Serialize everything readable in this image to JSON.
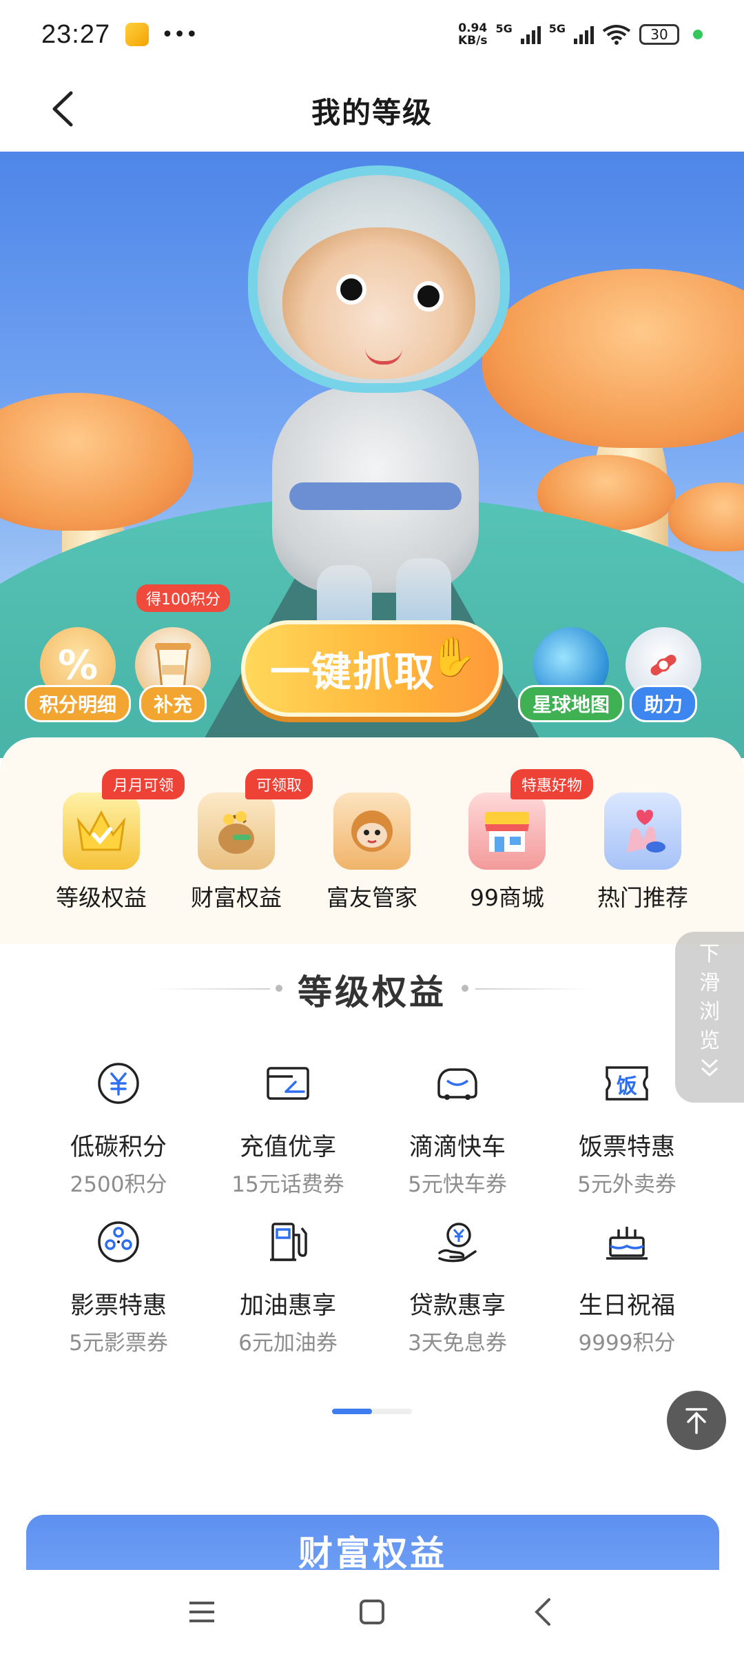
{
  "status_bar": {
    "time": "23:27",
    "dots": "•••",
    "net_speed_value": "0.94",
    "net_speed_unit": "KB/s",
    "signal1_label": "5G",
    "signal2_label": "5G",
    "battery": "30"
  },
  "header": {
    "title": "我的等级"
  },
  "hero": {
    "badges": [
      {
        "label": "积分明细",
        "glyph": "%",
        "color": "#f3a531"
      },
      {
        "label": "补充",
        "tip": "得100积分",
        "color": "#f3a531"
      },
      {
        "label": "星球地图",
        "color": "#3fb153"
      },
      {
        "label": "助力",
        "color": "#3d86f0"
      }
    ],
    "grab_button": "一键抓取"
  },
  "entries": [
    {
      "label": "等级权益",
      "tip": "月月可领",
      "icon": "crown-icon"
    },
    {
      "label": "财富权益",
      "tip": "可领取",
      "icon": "money-bag-icon"
    },
    {
      "label": "富友管家",
      "icon": "monkey-icon"
    },
    {
      "label": "99商城",
      "tip": "特惠好物",
      "icon": "shop-icon"
    },
    {
      "label": "热门推荐",
      "icon": "hand-heart-icon"
    }
  ],
  "section": {
    "title": "等级权益"
  },
  "benefits": [
    {
      "name": "低碳积分",
      "desc": "2500积分",
      "icon": "yuan-icon"
    },
    {
      "name": "充值优享",
      "desc": "15元话费券",
      "icon": "card-icon"
    },
    {
      "name": "滴滴快车",
      "desc": "5元快车券",
      "icon": "car-icon"
    },
    {
      "name": "饭票特惠",
      "desc": "5元外卖券",
      "icon": "meal-ticket-icon",
      "glyph": "饭"
    },
    {
      "name": "影票特惠",
      "desc": "5元影票券",
      "icon": "film-reel-icon"
    },
    {
      "name": "加油惠享",
      "desc": "6元加油券",
      "icon": "gas-pump-icon"
    },
    {
      "name": "贷款惠享",
      "desc": "3天免息券",
      "icon": "loan-icon"
    },
    {
      "name": "生日祝福",
      "desc": "9999积分",
      "icon": "cake-icon"
    }
  ],
  "side_tab": {
    "chars": [
      "下",
      "滑",
      "浏",
      "览"
    ]
  },
  "wealth": {
    "title": "财富权益"
  },
  "pager": {
    "active_index": 0,
    "pages": 2
  }
}
